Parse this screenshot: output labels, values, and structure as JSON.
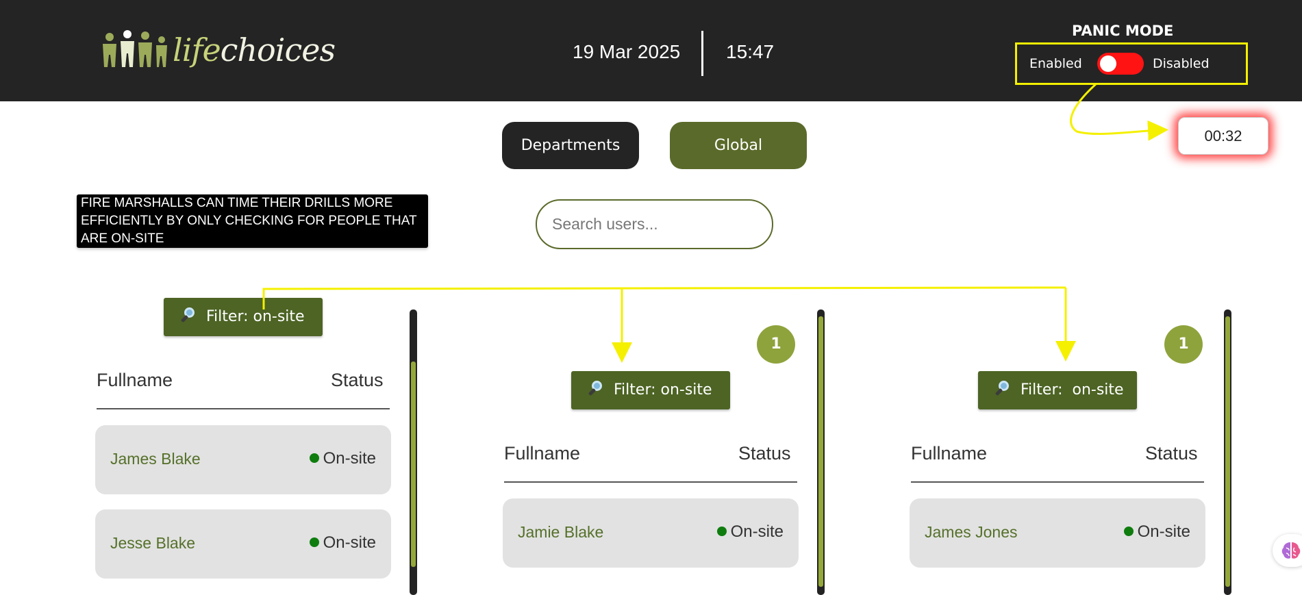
{
  "header": {
    "logo_text_life": "life",
    "logo_text_choices": "choices",
    "date": "19 Mar 2025",
    "time": "15:47"
  },
  "panic": {
    "title": "PANIC MODE",
    "enabled_label": "Enabled",
    "disabled_label": "Disabled"
  },
  "timer": "00:32",
  "nav": {
    "departments_label": "Departments",
    "global_label": "Global"
  },
  "note": "FIRE MARSHALLS CAN TIME THEIR DRILLS MORE EFFICIENTLY BY ONLY CHECKING FOR PEOPLE THAT ARE ON-SITE",
  "search": {
    "placeholder": "Search users..."
  },
  "panels": [
    {
      "filter_label": "Filter: on-site",
      "col_fullname": "Fullname",
      "col_status": "Status",
      "rows": [
        {
          "name": "James Blake",
          "status": "On-site"
        },
        {
          "name": "Jesse Blake",
          "status": "On-site"
        }
      ]
    },
    {
      "badge": "1",
      "filter_label": "Filter: on-site",
      "col_fullname": "Fullname",
      "col_status": "Status",
      "rows": [
        {
          "name": "Jamie Blake",
          "status": "On-site"
        }
      ]
    },
    {
      "badge": "1",
      "filter_label": "Filter:  on-site",
      "col_fullname": "Fullname",
      "col_status": "Status",
      "rows": [
        {
          "name": "James Jones",
          "status": "On-site"
        }
      ]
    }
  ],
  "colors": {
    "header_bg": "#242424",
    "brand_green": "#5a6a2a",
    "filter_green": "#4d6424",
    "badge_green": "#8ea33c",
    "panic_red": "#ff1313",
    "annotation_yellow": "#f4f000"
  },
  "icons": {
    "filter": "magnifier-icon",
    "status": "green-dot-icon",
    "assistant": "brain-icon"
  }
}
